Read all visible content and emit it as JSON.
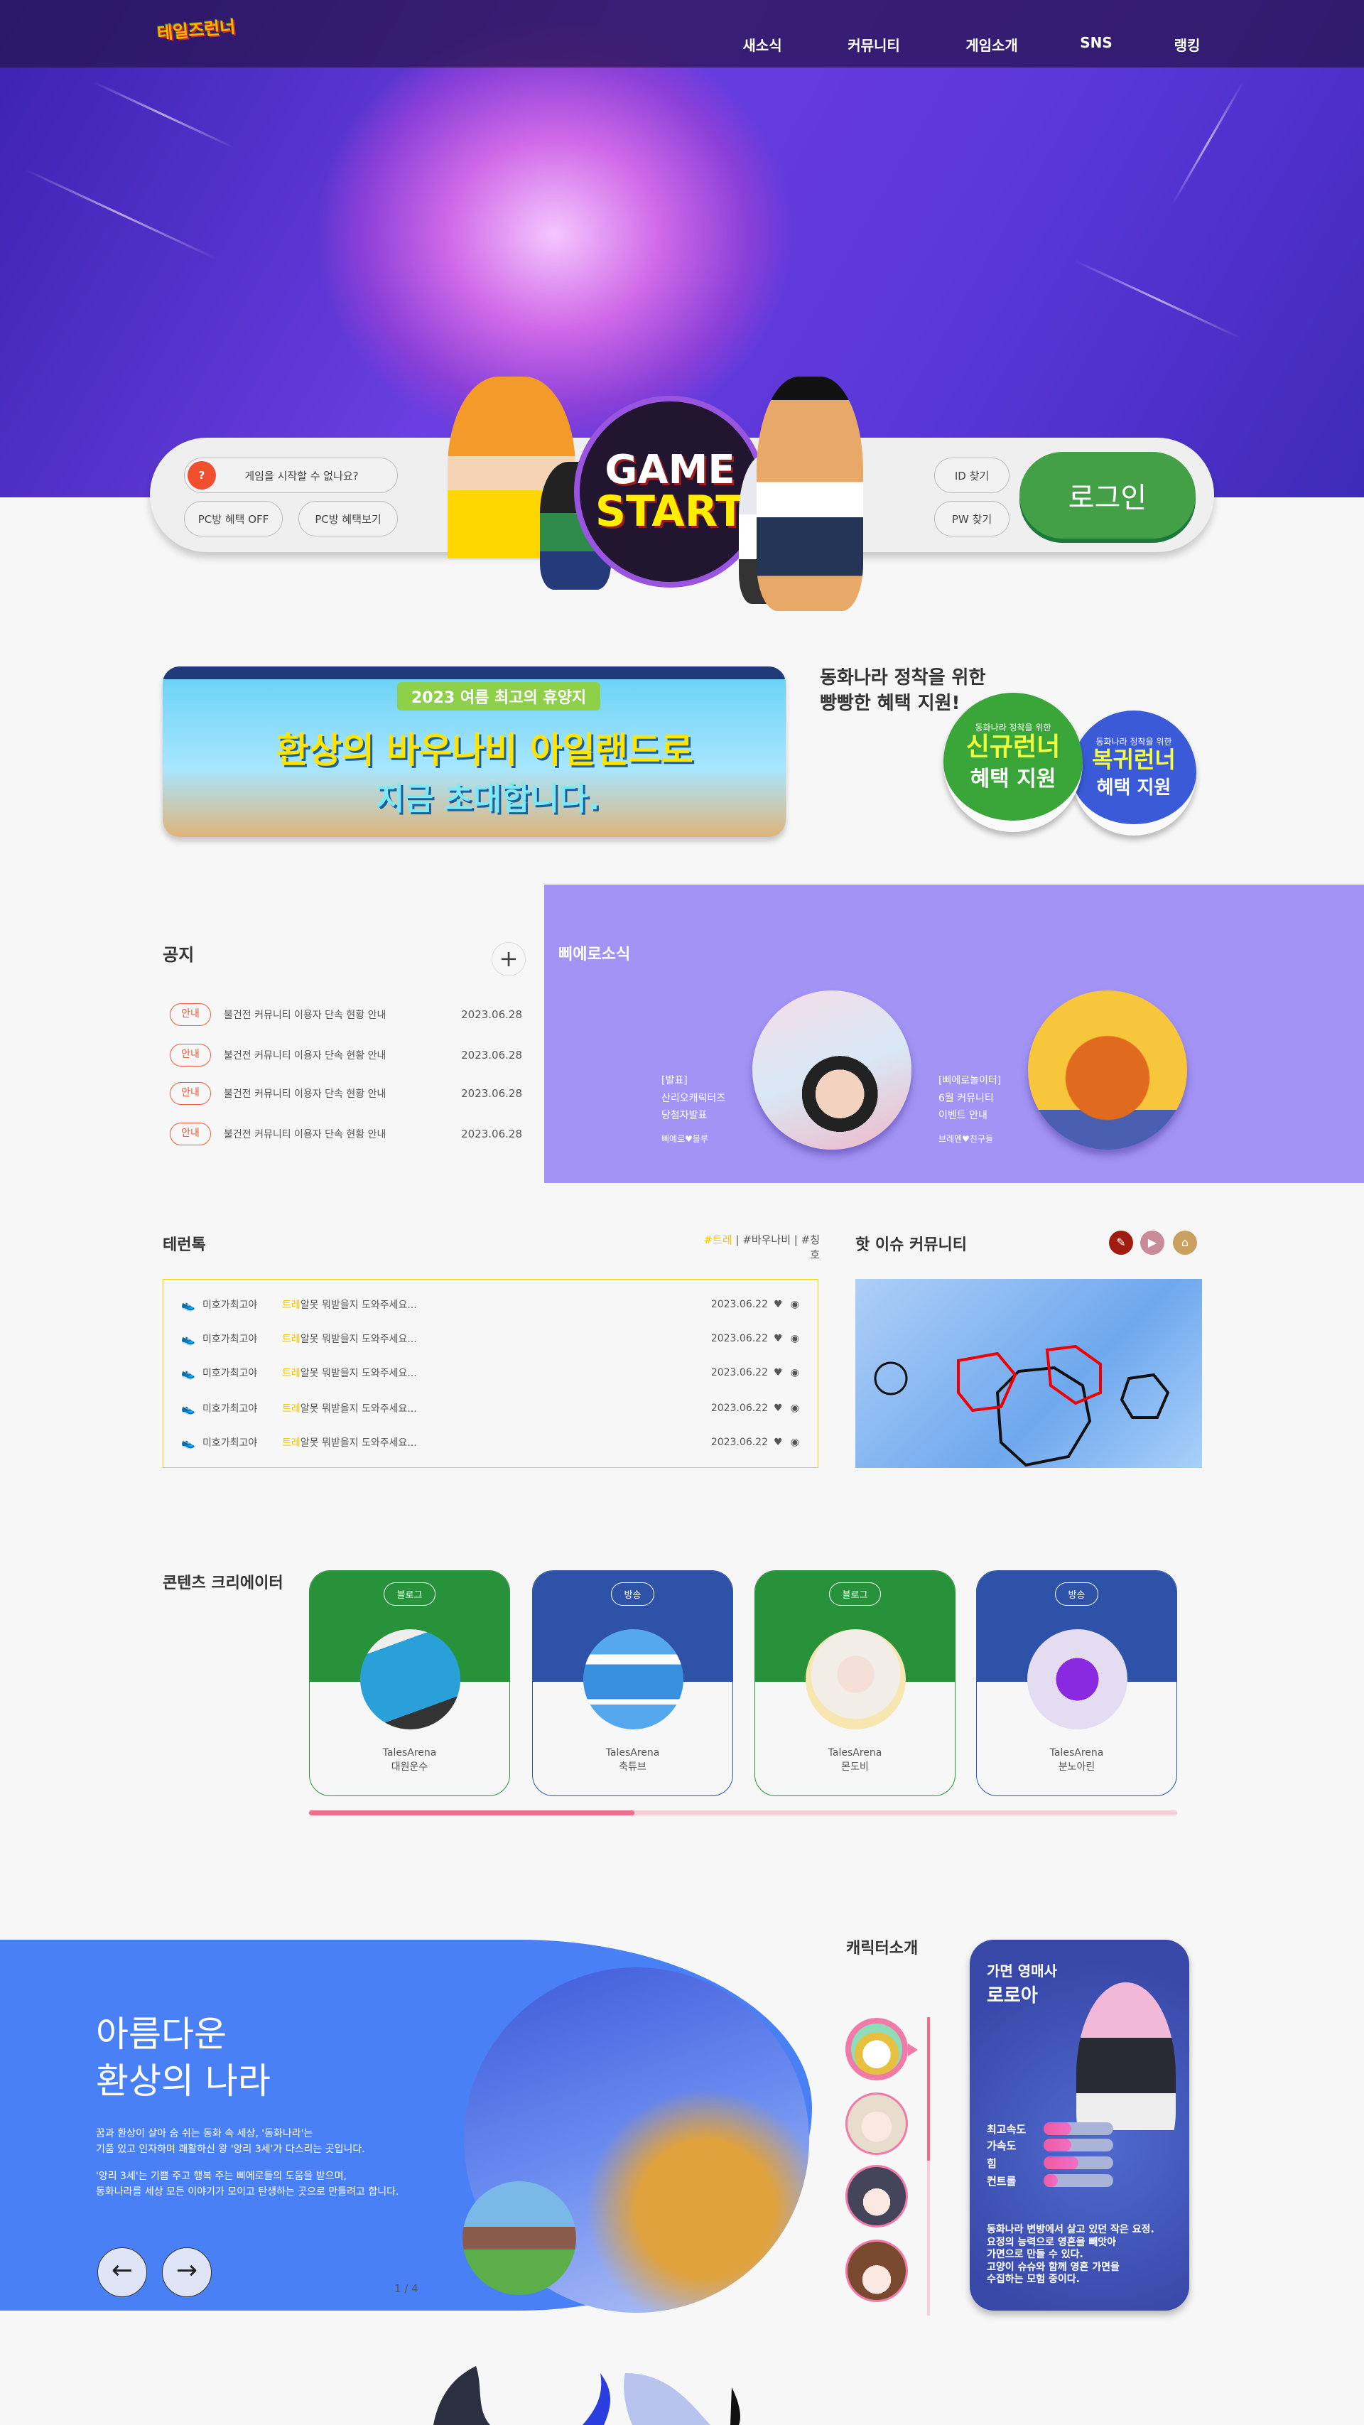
{
  "header": {
    "logo": "테일즈런너",
    "nav": [
      "새소식",
      "커뮤니티",
      "게임소개",
      "SNS",
      "랭킹"
    ]
  },
  "login": {
    "help_button": "게임을 시작할 수 없나요?",
    "pc_off": "PC방 혜택 OFF",
    "pc_view": "PC방 혜택보기",
    "game_start_top": "GAME",
    "game_start_bottom": "START",
    "find_id": "ID 찾기",
    "find_pw": "PW 찾기",
    "login_button": "로그인"
  },
  "banner": {
    "subtitle": "2023 여름 최고의 휴양지",
    "title": "환상의 바우나비 아일랜드로",
    "cta": "지금 초대합니다."
  },
  "benefit": {
    "headline_1": "동화나라 정착을 위한",
    "headline_2": "빵빵한 혜택 지원!",
    "cards": [
      {
        "top": "동화나라 정착을 위한",
        "big": "신규런너",
        "sub": "혜택 지원",
        "color": "#3aa63a"
      },
      {
        "top": "동화나라 정착을 위한",
        "big": "복귀런너",
        "sub": "혜택 지원",
        "color": "#3a5ad8"
      }
    ]
  },
  "notice": {
    "title": "공지",
    "more": "+",
    "items": [
      {
        "badge": "안내",
        "text": "불건전 커뮤니티 이용자 단속 현황 안내",
        "date": "2023.06.28"
      },
      {
        "badge": "안내",
        "text": "불건전 커뮤니티 이용자 단속 현황 안내",
        "date": "2023.06.28"
      },
      {
        "badge": "안내",
        "text": "불건전 커뮤니티 이용자 단속 현황 안내",
        "date": "2023.06.28"
      },
      {
        "badge": "안내",
        "text": "불건전 커뮤니티 이용자 단속 현황 안내",
        "date": "2023.06.28"
      }
    ]
  },
  "pierro": {
    "title": "삐에로소식",
    "items": [
      {
        "tag": "[발표]",
        "line1": "산리오캐릭터즈",
        "line2": "당첨자발표",
        "author": "삐에로♥블루"
      },
      {
        "tag": "[삐에로놀이터]",
        "line1": "6월 커뮤니티",
        "line2": "이벤트 안내",
        "author": "브레멘♥친구들"
      }
    ]
  },
  "talk": {
    "title": "테런톡",
    "tags": [
      "#트레",
      "#바우나비",
      "#칭호"
    ],
    "rows": [
      {
        "nick": "미호가최고야",
        "highlight": "트레",
        "text": "알못 뭐받을지 도와주세요...",
        "date": "2023.06.22"
      },
      {
        "nick": "미호가최고야",
        "highlight": "트레",
        "text": "알못 뭐받을지 도와주세요...",
        "date": "2023.06.22"
      },
      {
        "nick": "미호가최고야",
        "highlight": "트레",
        "text": "알못 뭐받을지 도와주세요...",
        "date": "2023.06.22"
      },
      {
        "nick": "미호가최고야",
        "highlight": "트레",
        "text": "알못 뭐받을지 도와주세요...",
        "date": "2023.06.22"
      },
      {
        "nick": "미호가최고야",
        "highlight": "트레",
        "text": "알못 뭐받을지 도와주세요...",
        "date": "2023.06.22"
      }
    ]
  },
  "hot": {
    "title": "핫 이슈 커뮤니티",
    "icons": [
      "palette-icon",
      "play-icon",
      "home-icon"
    ]
  },
  "creators": {
    "title": "콘텐츠 크리에이터",
    "cards": [
      {
        "type": "블로그",
        "site": "TalesArena",
        "name": "대원운수",
        "color": "#27923a"
      },
      {
        "type": "방송",
        "site": "TalesArena",
        "name": "축튜브",
        "color": "#2e52a8"
      },
      {
        "type": "블로그",
        "site": "TalesArena",
        "name": "몬도비",
        "color": "#27923a"
      },
      {
        "type": "방송",
        "site": "TalesArena",
        "name": "분노아린",
        "color": "#2e52a8"
      }
    ],
    "scroll_progress": 0.375
  },
  "world": {
    "title_1": "아름다운",
    "title_2": "환상의 나라",
    "p1_1": "꿈과 환상이 살아 숨 쉬는 동화 속 세상, '동화나라'는",
    "p1_2": "기품 있고 인자하며 쾌활하신 왕 '앙리 3세'가 다스리는 곳입니다.",
    "p2_1": "'앙리 3세'는 기쁨 주고 행복 주는 삐에로들의 도움을 받으며,",
    "p2_2": "동화나라를 세상 모든 이야기가 모이고 탄생하는 곳으로 만들려고 합니다.",
    "prev": "←",
    "next": "→",
    "pager": "1 / 4"
  },
  "characters": {
    "title": "캐릭터소개",
    "selected": {
      "job": "가면 영매사",
      "name": "로로아",
      "stats": [
        {
          "label": "최고속도",
          "value": 0.4
        },
        {
          "label": "가속도",
          "value": 0.4
        },
        {
          "label": "힘",
          "value": 0.5
        },
        {
          "label": "컨트롤",
          "value": 0.2
        }
      ],
      "desc": [
        "동화나라 변방에서 살고 있던 작은 요정.",
        "요정의 능력으로 영혼을 빼앗아",
        "가면으로 만들 수 있다.",
        "고양이 슈슈와 함께 영혼 가면을",
        "수집하는 모험 중이다."
      ]
    }
  }
}
